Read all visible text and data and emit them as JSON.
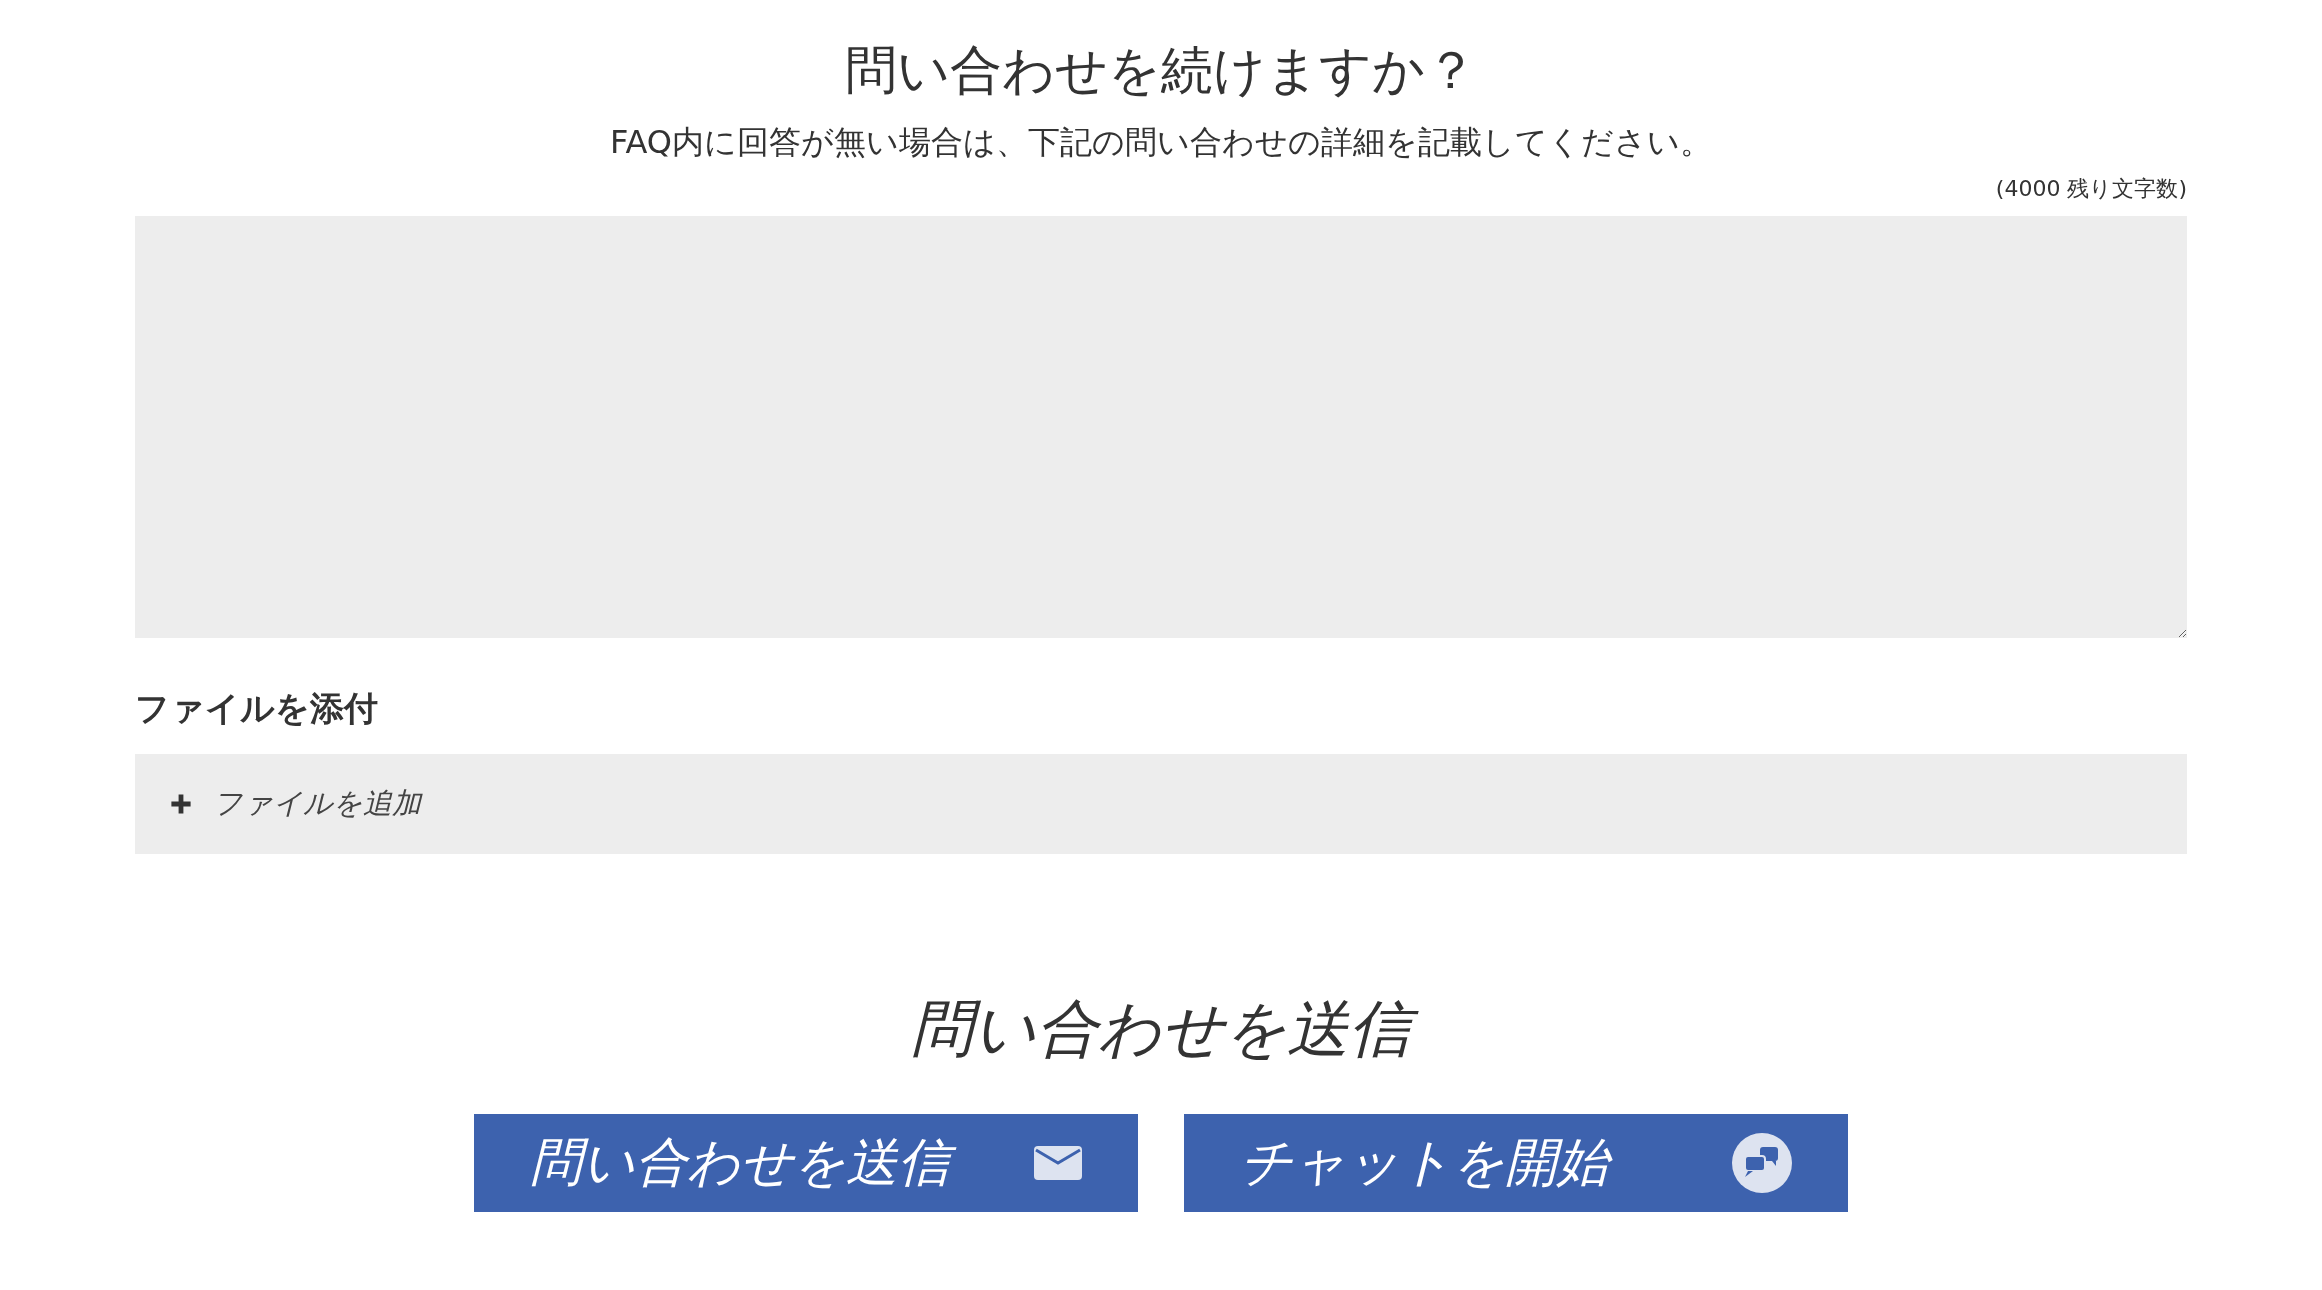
{
  "heading": "問い合わせを続けますか？",
  "subheading": "FAQ内に回答が無い場合は、下記の問い合わせの詳細を記載してください。",
  "message": {
    "counter": "(4000 残り文字数)"
  },
  "attachments": {
    "label": "ファイルを添付",
    "add_button": "ファイルを追加"
  },
  "submit_heading": "問い合わせを送信",
  "buttons": [
    {
      "kind": "mail",
      "label": "問い合わせを送信"
    },
    {
      "kind": "chat",
      "label": "チャットを開始"
    }
  ]
}
